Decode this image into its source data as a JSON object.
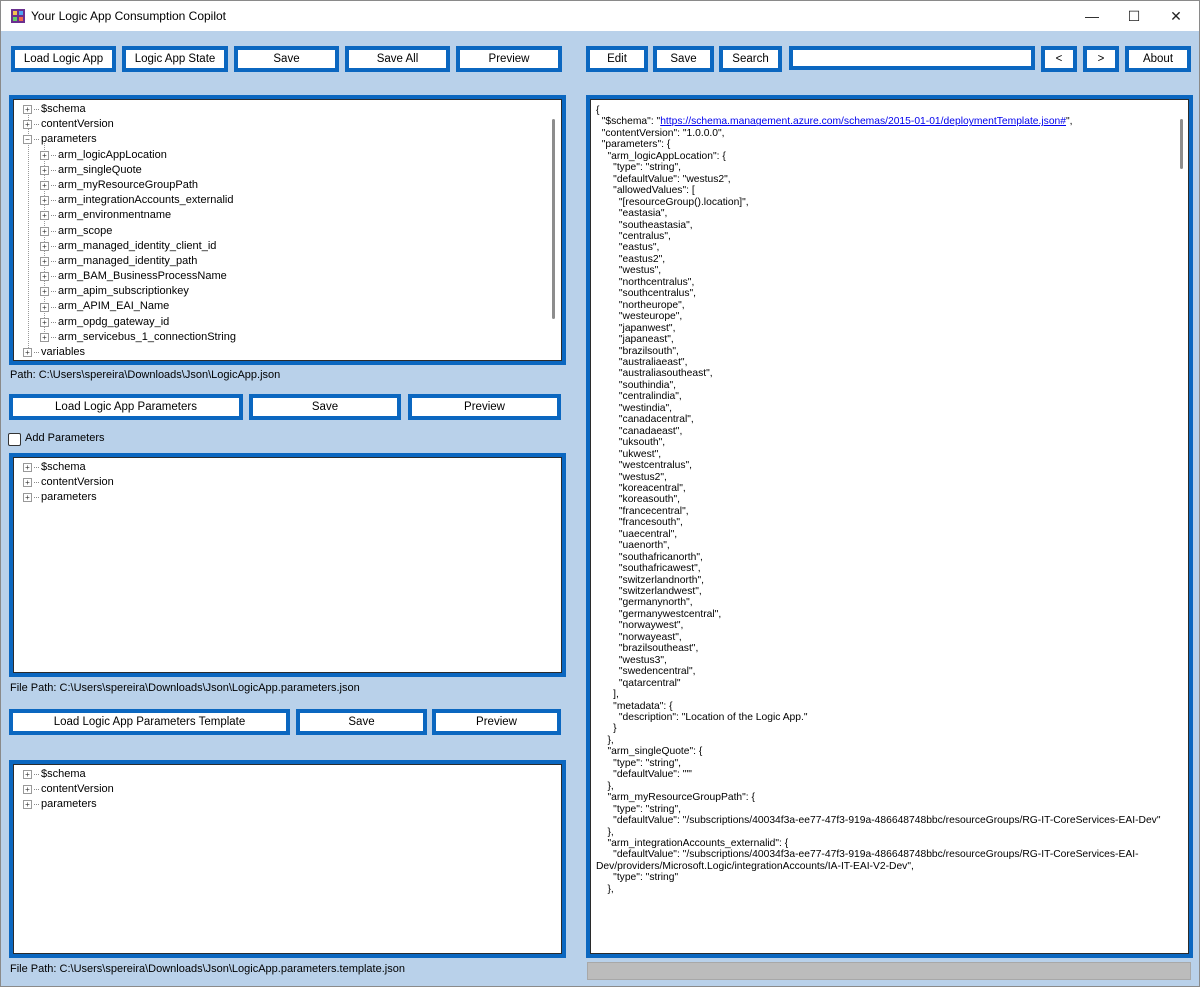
{
  "window": {
    "title": "Your Logic App Consumption Copilot",
    "controls": [
      "—",
      "☐",
      "✕"
    ]
  },
  "left_toolbar": {
    "load": "Load Logic App",
    "state": "Logic App State",
    "save": "Save",
    "save_all": "Save All",
    "preview": "Preview"
  },
  "right_toolbar": {
    "edit": "Edit",
    "save": "Save",
    "search": "Search",
    "search_value": "",
    "prev": "<",
    "next": ">",
    "about": "About"
  },
  "tree1": {
    "top": [
      "$schema",
      "contentVersion",
      "parameters"
    ],
    "children": [
      "arm_logicAppLocation",
      "arm_singleQuote",
      "arm_myResourceGroupPath",
      "arm_integrationAccounts_externalid",
      "arm_environmentname",
      "arm_scope",
      "arm_managed_identity_client_id",
      "arm_managed_identity_path",
      "arm_BAM_BusinessProcessName",
      "arm_apim_subscriptionkey",
      "arm_APIM_EAI_Name",
      "arm_opdg_gateway_id",
      "arm_servicebus_1_connectionString"
    ],
    "bottom": [
      "variables"
    ]
  },
  "path1": "Path: C:\\Users\\spereira\\Downloads\\Json\\LogicApp.json",
  "params_toolbar": {
    "load": "Load Logic App Parameters",
    "save": "Save",
    "preview": "Preview"
  },
  "add_parameters": "Add Parameters",
  "tree2": [
    "$schema",
    "contentVersion",
    "parameters"
  ],
  "path2": "File Path: C:\\Users\\spereira\\Downloads\\Json\\LogicApp.parameters.json",
  "template_toolbar": {
    "load": "Load Logic App Parameters Template",
    "save": "Save",
    "preview": "Preview"
  },
  "tree3": [
    "$schema",
    "contentVersion",
    "parameters"
  ],
  "path3": "File Path: C:\\Users\\spereira\\Downloads\\Json\\LogicApp.parameters.template.json",
  "json_view": {
    "lines": [
      "{",
      "  \"$schema\": \"",
      "  \"contentVersion\": \"1.0.0.0\",",
      "  \"parameters\": {",
      "    \"arm_logicAppLocation\": {",
      "      \"type\": \"string\",",
      "      \"defaultValue\": \"westus2\",",
      "      \"allowedValues\": [",
      "        \"[resourceGroup().location]\",",
      "        \"eastasia\",",
      "        \"southeastasia\",",
      "        \"centralus\",",
      "        \"eastus\",",
      "        \"eastus2\",",
      "        \"westus\",",
      "        \"northcentralus\",",
      "        \"southcentralus\",",
      "        \"northeurope\",",
      "        \"westeurope\",",
      "        \"japanwest\",",
      "        \"japaneast\",",
      "        \"brazilsouth\",",
      "        \"australiaeast\",",
      "        \"australiasoutheast\",",
      "        \"southindia\",",
      "        \"centralindia\",",
      "        \"westindia\",",
      "        \"canadacentral\",",
      "        \"canadaeast\",",
      "        \"uksouth\",",
      "        \"ukwest\",",
      "        \"westcentralus\",",
      "        \"westus2\",",
      "        \"koreacentral\",",
      "        \"koreasouth\",",
      "        \"francecentral\",",
      "        \"francesouth\",",
      "        \"uaecentral\",",
      "        \"uaenorth\",",
      "        \"southafricanorth\",",
      "        \"southafricawest\",",
      "        \"switzerlandnorth\",",
      "        \"switzerlandwest\",",
      "        \"germanynorth\",",
      "        \"germanywestcentral\",",
      "        \"norwaywest\",",
      "        \"norwayeast\",",
      "        \"brazilsoutheast\",",
      "        \"westus3\",",
      "        \"swedencentral\",",
      "        \"qatarcentral\"",
      "      ],",
      "      \"metadata\": {",
      "        \"description\": \"Location of the Logic App.\"",
      "      }",
      "    },",
      "    \"arm_singleQuote\": {",
      "      \"type\": \"string\",",
      "      \"defaultValue\": \"'\"",
      "    },",
      "    \"arm_myResourceGroupPath\": {",
      "      \"type\": \"string\",",
      "      \"defaultValue\": \"/subscriptions/40034f3a-ee77-47f3-919a-486648748bbc/resourceGroups/RG-IT-CoreServices-EAI-Dev\"",
      "    },",
      "    \"arm_integrationAccounts_externalid\": {",
      "      \"defaultValue\": \"/subscriptions/40034f3a-ee77-47f3-919a-486648748bbc/resourceGroups/RG-IT-CoreServices-EAI-",
      "Dev/providers/Microsoft.Logic/integrationAccounts/IA-IT-EAI-V2-Dev\",",
      "      \"type\": \"string\"",
      "    },"
    ],
    "schema_link": "https://schema.management.azure.com/schemas/2015-01-01/deploymentTemplate.json#",
    "schema_suffix": "\","
  },
  "colors": {
    "accent": "#0b67c0",
    "background": "#b9d1ea"
  }
}
